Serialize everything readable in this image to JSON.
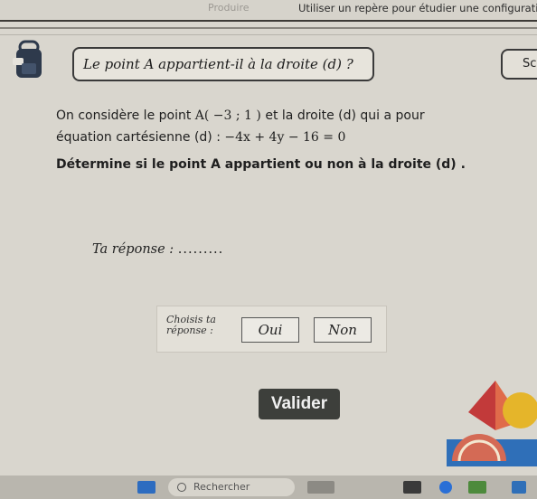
{
  "header": {
    "faded_text": "Produire",
    "breadcrumb": "Utiliser un repère pour étudier une configuration."
  },
  "question": {
    "title": "Le point A appartient-il à la droite (d) ?",
    "score_label": "Sco"
  },
  "statement": {
    "line1_prefix": "On considère le point ",
    "point": "A( −3 ; 1 )",
    "line1_suffix": " et la droite (d) qui a pour",
    "line2_prefix": "équation cartésienne (d) : ",
    "equation": "−4x + 4y − 16 = 0",
    "line3": "Détermine si le point A appartient ou non à la droite (d) ."
  },
  "answer": {
    "label": "Ta réponse : ",
    "placeholder": ".........",
    "choose_label_1": "Choisis ta",
    "choose_label_2": "réponse :",
    "option_yes": "Oui",
    "option_no": "Non"
  },
  "actions": {
    "validate_label": "Valider"
  },
  "taskbar": {
    "search_placeholder": "Rechercher"
  },
  "colors": {
    "background": "#d9d6ce",
    "validate_bg": "#3d3f3b",
    "accent_red": "#c23a3a",
    "accent_yellow": "#e5b52a",
    "accent_blue": "#2f6fb8"
  }
}
